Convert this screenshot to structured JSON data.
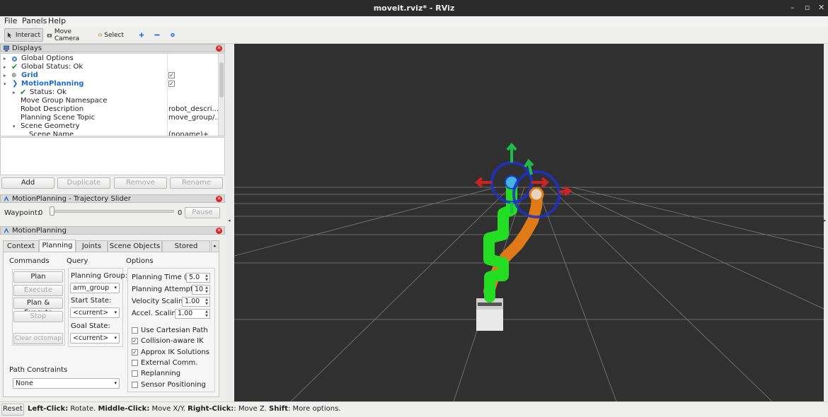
{
  "window": {
    "title": "moveit.rviz* - RViz"
  },
  "menu": {
    "file": "File",
    "panels": "Panels",
    "help": "Help"
  },
  "toolbar": {
    "interact": "Interact",
    "move_camera": "Move Camera",
    "select": "Select"
  },
  "displays": {
    "title": "Displays",
    "rows": {
      "global_options": "Global Options",
      "global_status": "Global Status: Ok",
      "grid": "Grid",
      "motion_planning": "MotionPlanning",
      "status": "Status: Ok",
      "move_group_ns": "Move Group Namespace",
      "robot_description": "Robot Description",
      "robot_description_value": "robot_descri...",
      "planning_scene_topic": "Planning Scene Topic",
      "planning_scene_topic_value": "move_group/...",
      "scene_geometry": "Scene Geometry",
      "scene_name": "Scene Name",
      "scene_name_value": "(noname)+"
    },
    "buttons": {
      "add": "Add",
      "duplicate": "Duplicate",
      "remove": "Remove",
      "rename": "Rename"
    }
  },
  "trajectory": {
    "title": "MotionPlanning - Trajectory Slider",
    "waypoint_label": "Waypoint:",
    "waypoint_min": "0",
    "waypoint_max": "0",
    "pause": "Pause"
  },
  "motion_planning": {
    "title": "MotionPlanning",
    "tabs": [
      "Context",
      "Planning",
      "Joints",
      "Scene Objects",
      "Stored Scene"
    ],
    "commands": {
      "header": "Commands",
      "plan": "Plan",
      "execute": "Execute",
      "plan_execute": "Plan & Execute",
      "stop": "Stop",
      "clear_octomap": "Clear octomap"
    },
    "query": {
      "header": "Query",
      "planning_group_label": "Planning Group:",
      "planning_group": "arm_group",
      "start_state_label": "Start State:",
      "start_state": "<current>",
      "goal_state_label": "Goal State:",
      "goal_state": "<current>"
    },
    "options": {
      "header": "Options",
      "planning_time_label": "Planning Time (s):",
      "planning_time": "5.0",
      "planning_attempts_label": "Planning Attempts:",
      "planning_attempts": "10",
      "velocity_scaling_label": "Velocity Scaling:",
      "velocity_scaling": "1.00",
      "accel_scaling_label": "Accel. Scaling:",
      "accel_scaling": "1.00",
      "checks": {
        "cartesian": "Use Cartesian Path",
        "collision_ik": "Collision-aware IK",
        "approx_ik": "Approx IK Solutions",
        "external_comm": "External Comm.",
        "replanning": "Replanning",
        "sensor_positioning": "Sensor Positioning"
      }
    },
    "path_constraints": {
      "header": "Path Constraints",
      "value": "None"
    }
  },
  "status": {
    "reset": "Reset",
    "left_click": "Left-Click:",
    "left_click_desc": " Rotate. ",
    "middle_click": "Middle-Click:",
    "middle_click_desc": " Move X/Y. ",
    "right_click": "Right-Click:",
    "right_click_desc": ": Move Z. ",
    "shift": "Shift",
    "shift_desc": ": More options."
  },
  "colors": {
    "green_link": "#22dd22",
    "orange_link": "#e07a18",
    "accent_blue": "#1a6bd0",
    "viewport_bg": "#303030"
  }
}
